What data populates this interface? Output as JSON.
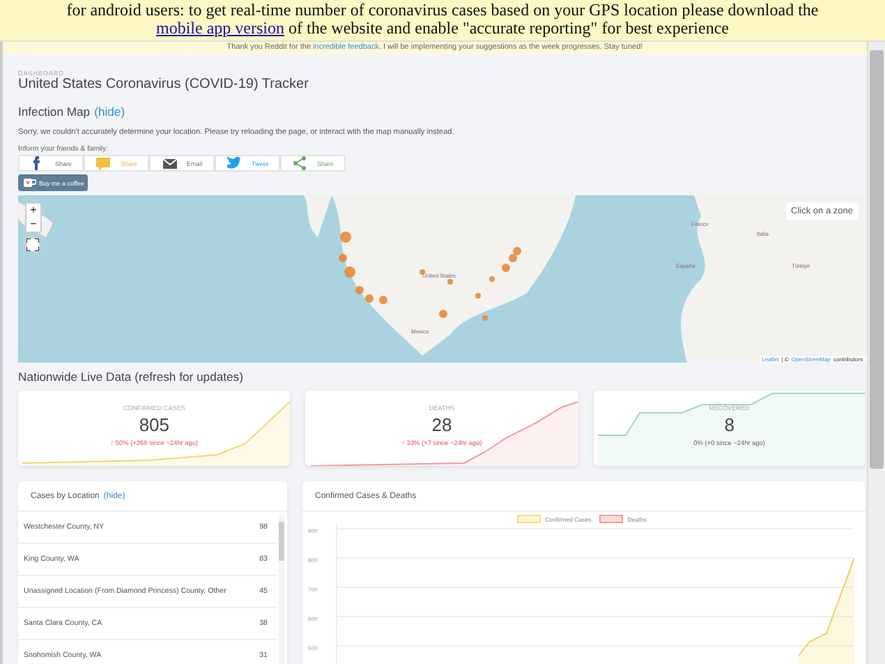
{
  "android_banner": {
    "text_before": "for android users: to get real-time number of coronavirus cases based on your GPS location please download the",
    "link": "mobile app version",
    "text_after": "of the website and enable \"accurate reporting\" for best experience"
  },
  "notice": {
    "text_before": "Thank you Reddit for the",
    "link": "incredible feedback",
    "text_after": ". I will be implementing your suggestions as the week progresses. Stay tuned!"
  },
  "header": {
    "eyebrow": "DASHBOARD",
    "title": "United States Coronavirus (COVID-19) Tracker"
  },
  "infection_map": {
    "title": "Infection Map",
    "toggle": "(hide)",
    "message": "Sorry, we couldn't accurately determine your location. Please try reloading the page, or interact with the map manually instead.",
    "share_label": "Inform your friends & family:",
    "share_buttons": [
      {
        "kind": "facebook",
        "label": "Share"
      },
      {
        "kind": "sms",
        "label": "Share"
      },
      {
        "kind": "email",
        "label": "Email"
      },
      {
        "kind": "twitter",
        "label": "Tweet"
      },
      {
        "kind": "share",
        "label": "Share"
      }
    ],
    "coffee_button": "Buy me a coffee",
    "map": {
      "zoom_in": "+",
      "zoom_out": "−",
      "info": "Click on a zone",
      "attribution_link_1": "Leaflet",
      "attribution_sep": "| ©",
      "attribution_link_2": "OpenStreetMap",
      "attribution_end": "contributors",
      "places": [
        {
          "label": "United States"
        },
        {
          "label": "Mexico"
        },
        {
          "label": "France"
        },
        {
          "label": "España"
        },
        {
          "label": "Italia"
        },
        {
          "label": "Türkiye"
        }
      ]
    }
  },
  "live_data": {
    "title": "Nationwide Live Data (refresh for updates)",
    "cards": [
      {
        "kind": "confirmed",
        "label": "CONFIRMED CASES",
        "value": "805",
        "change": "↑ 50% (+268 since ~24hr ago)",
        "color": "#f5d66b"
      },
      {
        "kind": "deaths",
        "label": "DEATHS",
        "value": "28",
        "change": "↑ 33% (+7 since ~24hr ago)",
        "color": "#f29a9a"
      },
      {
        "kind": "recovered",
        "label": "RECOVERED",
        "value": "8",
        "change": "0% (+0 since ~24hr ago)",
        "color": "#9fd9c0"
      }
    ]
  },
  "locations": {
    "title": "Cases by Location",
    "toggle": "(hide)",
    "rows": [
      {
        "name": "Westchester County, NY",
        "count": "98"
      },
      {
        "name": "King County, WA",
        "count": "83"
      },
      {
        "name": "Unassigned Location (From Diamond Princess) County, Other",
        "count": "45"
      },
      {
        "name": "Santa Clara County, CA",
        "count": "38"
      },
      {
        "name": "Snohomish County, WA",
        "count": "31"
      }
    ]
  },
  "chart_panel": {
    "title": "Confirmed Cases & Deaths",
    "legend": [
      {
        "label": "Confirmed Cases",
        "color": "#f5e27a"
      },
      {
        "label": "Deaths",
        "color": "#f29a9a"
      }
    ],
    "y_axis_labels": [
      "900",
      "800",
      "700",
      "600",
      "500"
    ]
  }
}
